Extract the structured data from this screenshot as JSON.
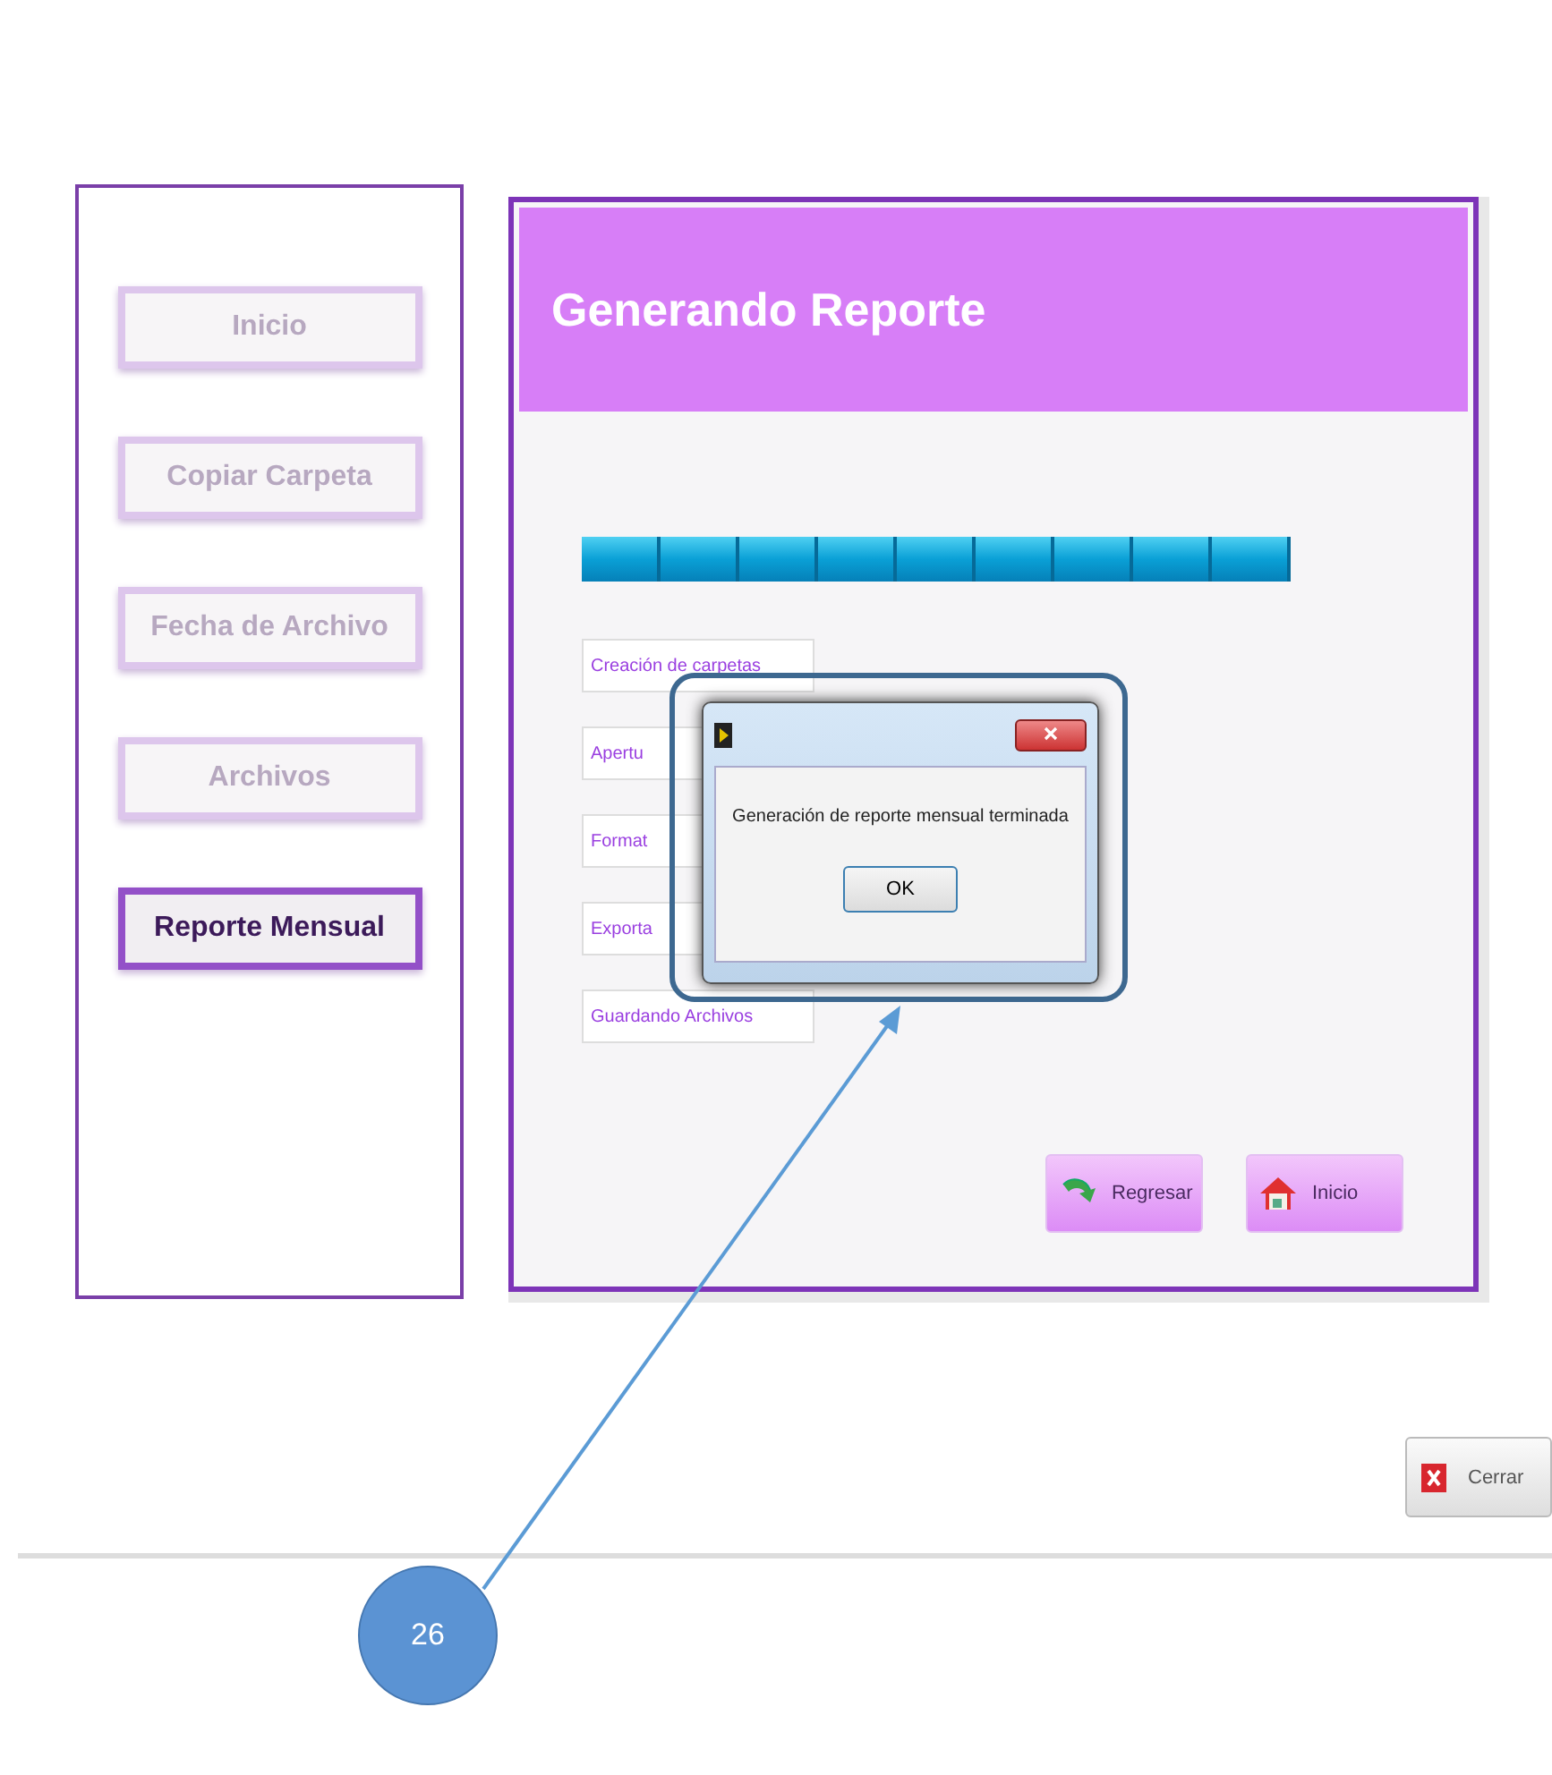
{
  "sidebar": {
    "items": [
      {
        "label": "Inicio",
        "selected": false
      },
      {
        "label": "Copiar Carpeta",
        "selected": false
      },
      {
        "label": "Fecha de Archivo",
        "selected": false
      },
      {
        "label": "Archivos",
        "selected": false
      },
      {
        "label": "Reporte Mensual",
        "selected": true
      }
    ]
  },
  "panel": {
    "title": "Generando Reporte",
    "progress": {
      "level": 1
    },
    "steps": [
      "Creación de carpetas",
      "Apertu",
      "Format",
      "Exporta",
      "Guardando Archivos"
    ],
    "buttons": [
      {
        "kind": "back",
        "label": "Regresar"
      },
      {
        "kind": "home",
        "label": "Inicio"
      }
    ]
  },
  "dialog": {
    "message": "Generación de reporte mensual terminada",
    "button": "OK"
  },
  "close_button": {
    "label": "Cerrar"
  },
  "callout": {
    "number": "26"
  }
}
